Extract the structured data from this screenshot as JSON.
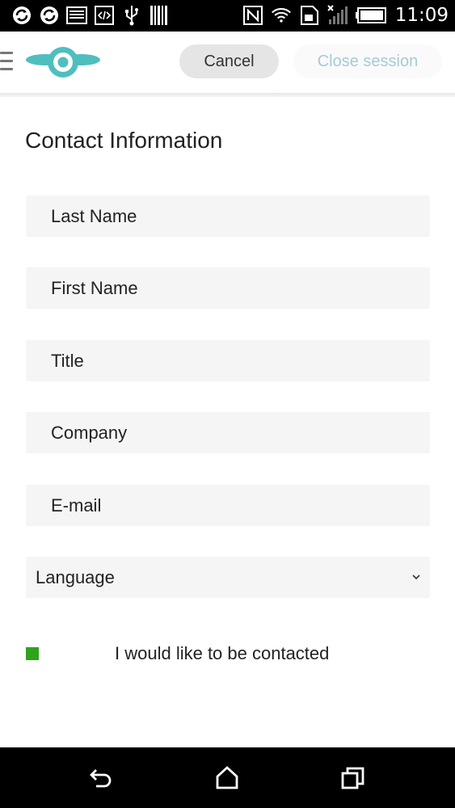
{
  "status_bar": {
    "time": "11:09",
    "left_icons": [
      "sync-icon",
      "sync-icon",
      "image-icon",
      "code-icon",
      "usb-icon",
      "barcode-icon"
    ],
    "right_icons": [
      "nfc-icon",
      "wifi-icon",
      "sim-icon",
      "signal-icon",
      "battery-icon"
    ]
  },
  "header": {
    "cancel_label": "Cancel",
    "close_session_label": "Close session"
  },
  "form": {
    "title": "Contact Information",
    "fields": [
      {
        "placeholder": "Last Name"
      },
      {
        "placeholder": "First Name"
      },
      {
        "placeholder": "Title"
      },
      {
        "placeholder": "Company"
      },
      {
        "placeholder": "E-mail"
      }
    ],
    "language_select": {
      "value": "Language"
    },
    "contact_opt_in": {
      "label": "I would like to be contacted",
      "checked": true
    }
  },
  "colors": {
    "logo_teal": "#4fbfbd",
    "checkbox_green": "#2fa31a",
    "close_session_text": "#a6cbd6"
  },
  "nav_bar": {
    "icons": [
      "back-icon",
      "home-icon",
      "recents-icon"
    ]
  }
}
